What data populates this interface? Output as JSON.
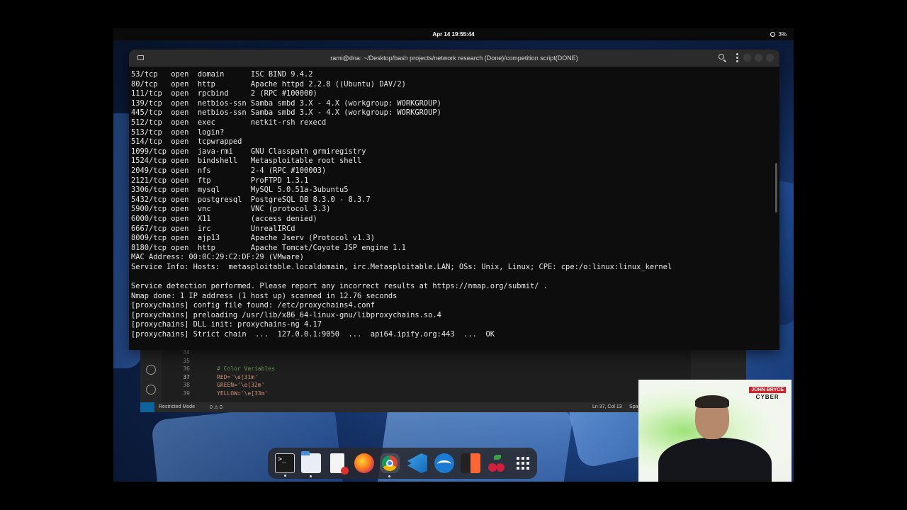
{
  "topbar": {
    "clock": "Apr 14  19:55:44",
    "battery": "3%"
  },
  "terminal": {
    "title": "rami@dna: ~/Desktop/bash projects/network research (Done)/competition script(DONE)",
    "lines": [
      "53/tcp   open  domain      ISC BIND 9.4.2",
      "80/tcp   open  http        Apache httpd 2.2.8 ((Ubuntu) DAV/2)",
      "111/tcp  open  rpcbind     2 (RPC #100000)",
      "139/tcp  open  netbios-ssn Samba smbd 3.X - 4.X (workgroup: WORKGROUP)",
      "445/tcp  open  netbios-ssn Samba smbd 3.X - 4.X (workgroup: WORKGROUP)",
      "512/tcp  open  exec        netkit-rsh rexecd",
      "513/tcp  open  login?",
      "514/tcp  open  tcpwrapped",
      "1099/tcp open  java-rmi    GNU Classpath grmiregistry",
      "1524/tcp open  bindshell   Metasploitable root shell",
      "2049/tcp open  nfs         2-4 (RPC #100003)",
      "2121/tcp open  ftp         ProFTPD 1.3.1",
      "3306/tcp open  mysql       MySQL 5.0.51a-3ubuntu5",
      "5432/tcp open  postgresql  PostgreSQL DB 8.3.0 - 8.3.7",
      "5900/tcp open  vnc         VNC (protocol 3.3)",
      "6000/tcp open  X11         (access denied)",
      "6667/tcp open  irc         UnrealIRCd",
      "8009/tcp open  ajp13       Apache Jserv (Protocol v1.3)",
      "8180/tcp open  http        Apache Tomcat/Coyote JSP engine 1.1",
      "MAC Address: 00:0C:29:C2:DF:29 (VMware)",
      "Service Info: Hosts:  metasploitable.localdomain, irc.Metasploitable.LAN; OSs: Unix, Linux; CPE: cpe:/o:linux:linux_kernel",
      "",
      "Service detection performed. Please report any incorrect results at https://nmap.org/submit/ .",
      "Nmap done: 1 IP address (1 host up) scanned in 12.76 seconds",
      "[proxychains] config file found: /etc/proxychains4.conf",
      "[proxychains] preloading /usr/lib/x86_64-linux-gnu/libproxychains.so.4",
      "[proxychains] DLL init: proxychains-ng 4.17",
      "[proxychains] Strict chain  ...  127.0.0.1:9050  ...  api64.ipify.org:443  ...  OK"
    ]
  },
  "editor": {
    "lines": [
      {
        "num": "34",
        "code": "",
        "color": "#d4d4d4"
      },
      {
        "num": "35",
        "code": "",
        "color": "#d4d4d4"
      },
      {
        "num": "36",
        "code": "# Color Variables",
        "color": "#6a9955"
      },
      {
        "num": "37",
        "code": "RED='\\e[31m'",
        "color": "#ce9178"
      },
      {
        "num": "38",
        "code": "GREEN='\\e[32m'",
        "color": "#ce9178"
      },
      {
        "num": "39",
        "code": "YELLOW='\\e[33m'",
        "color": "#ce9178"
      }
    ],
    "status": {
      "restricted": "Restricted Mode",
      "errors": "0 ⚠ 0",
      "position": "Ln 37, Col 13",
      "spaces": "Spa"
    }
  },
  "webcam": {
    "brand_top": "JOHN BRYCE",
    "brand_bottom": "CYBER"
  },
  "dock": {
    "items": [
      "terminal-icon",
      "files-icon",
      "text-editor-icon",
      "firefox-icon",
      "chrome-icon",
      "vscode-icon",
      "wireshark-icon",
      "burpsuite-icon",
      "cherrytree-icon",
      "app-grid-icon"
    ]
  }
}
